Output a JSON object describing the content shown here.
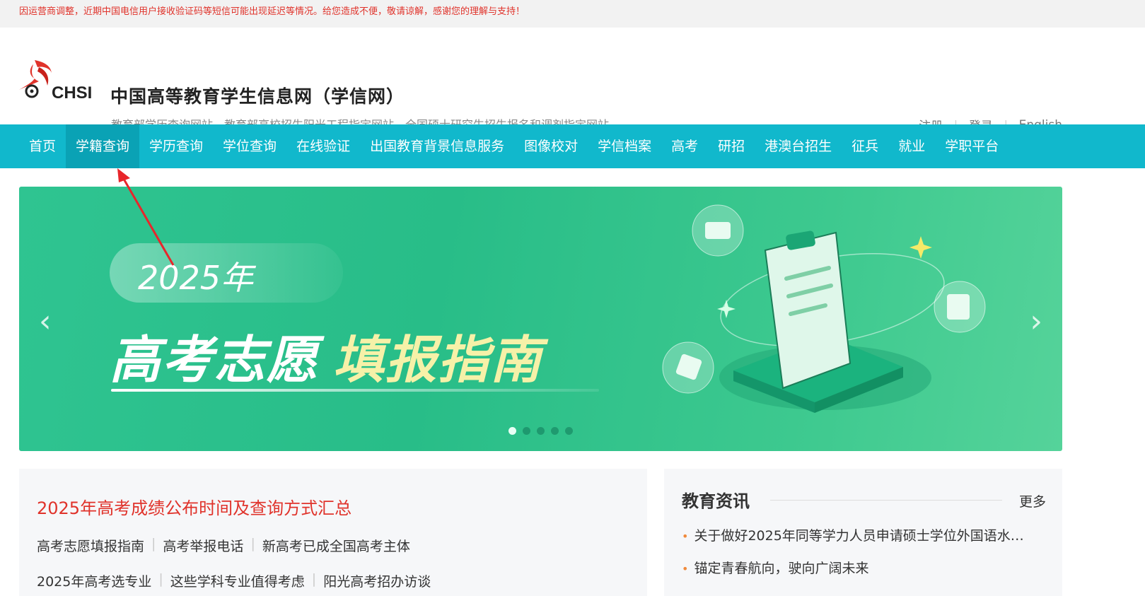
{
  "notice": "因运营商调整，近期中国电信用户接收验证码等短信可能出现延迟等情况。给您造成不便，敬请谅解，感谢您的理解与支持！",
  "header": {
    "logo_text": "CHSI",
    "title": "中国高等教育学生信息网（学信网）",
    "subtitle": "教育部学历查询网站、教育部高校招生阳光工程指定网站、全国硕士研究生招生报名和调剂指定网站",
    "links": [
      "注册",
      "登录",
      "English"
    ]
  },
  "nav": {
    "items": [
      "首页",
      "学籍查询",
      "学历查询",
      "学位查询",
      "在线验证",
      "出国教育背景信息服务",
      "图像校对",
      "学信档案",
      "高考",
      "研招",
      "港澳台招生",
      "征兵",
      "就业",
      "学职平台"
    ],
    "active": "学籍查询"
  },
  "banner": {
    "year": "2025年",
    "headline_a": "高考志愿",
    "headline_b": "填报指南",
    "prev_icon": "chevron-left-icon",
    "next_icon": "chevron-right-icon",
    "slide_count": 5,
    "active_slide": 1
  },
  "news_left": {
    "main_link": "2025年高考成绩公布时间及查询方式汇总",
    "row1": [
      "高考志愿填报指南",
      "高考举报电话",
      "新高考已成全国高考主体"
    ],
    "row2": [
      "2025年高考选专业",
      "这些学科专业值得考虑",
      "阳光高考招办访谈"
    ]
  },
  "news_right": {
    "title": "教育资讯",
    "more": "更多",
    "items": [
      "关于做好2025年同等学力人员申请硕士学位外国语水…",
      "锚定青春航向，驶向广阔未来"
    ]
  },
  "colors": {
    "nav_bg": "#11b8cc",
    "nav_active": "#0aa2b5",
    "notice_text": "#e0332b",
    "banner_green": "#2fc491",
    "accent_yellow": "#f6f1a8"
  }
}
